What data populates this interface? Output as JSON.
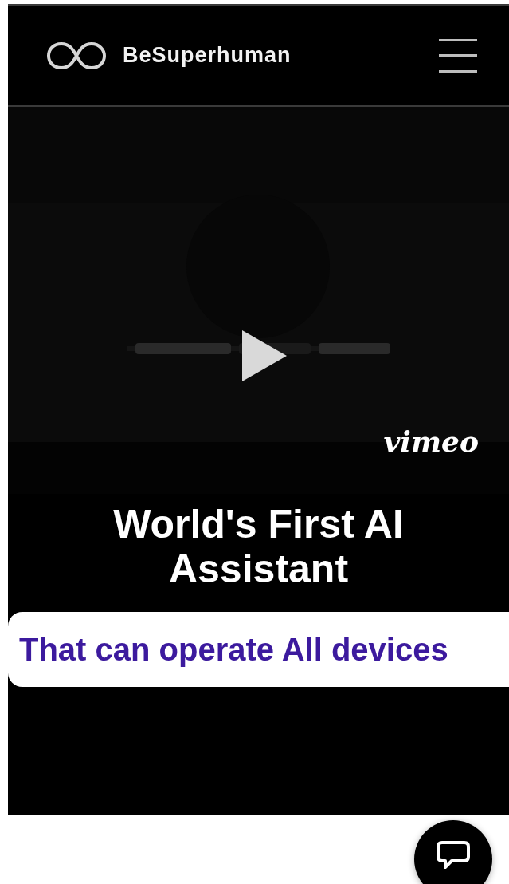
{
  "header": {
    "brand": "BeSuperhuman"
  },
  "video": {
    "kind": "picture",
    "player_logo": "vimeo"
  },
  "hero": {
    "title_lines": [
      "World's First AI",
      "Assistant"
    ],
    "banner": "That can operate All devices"
  }
}
